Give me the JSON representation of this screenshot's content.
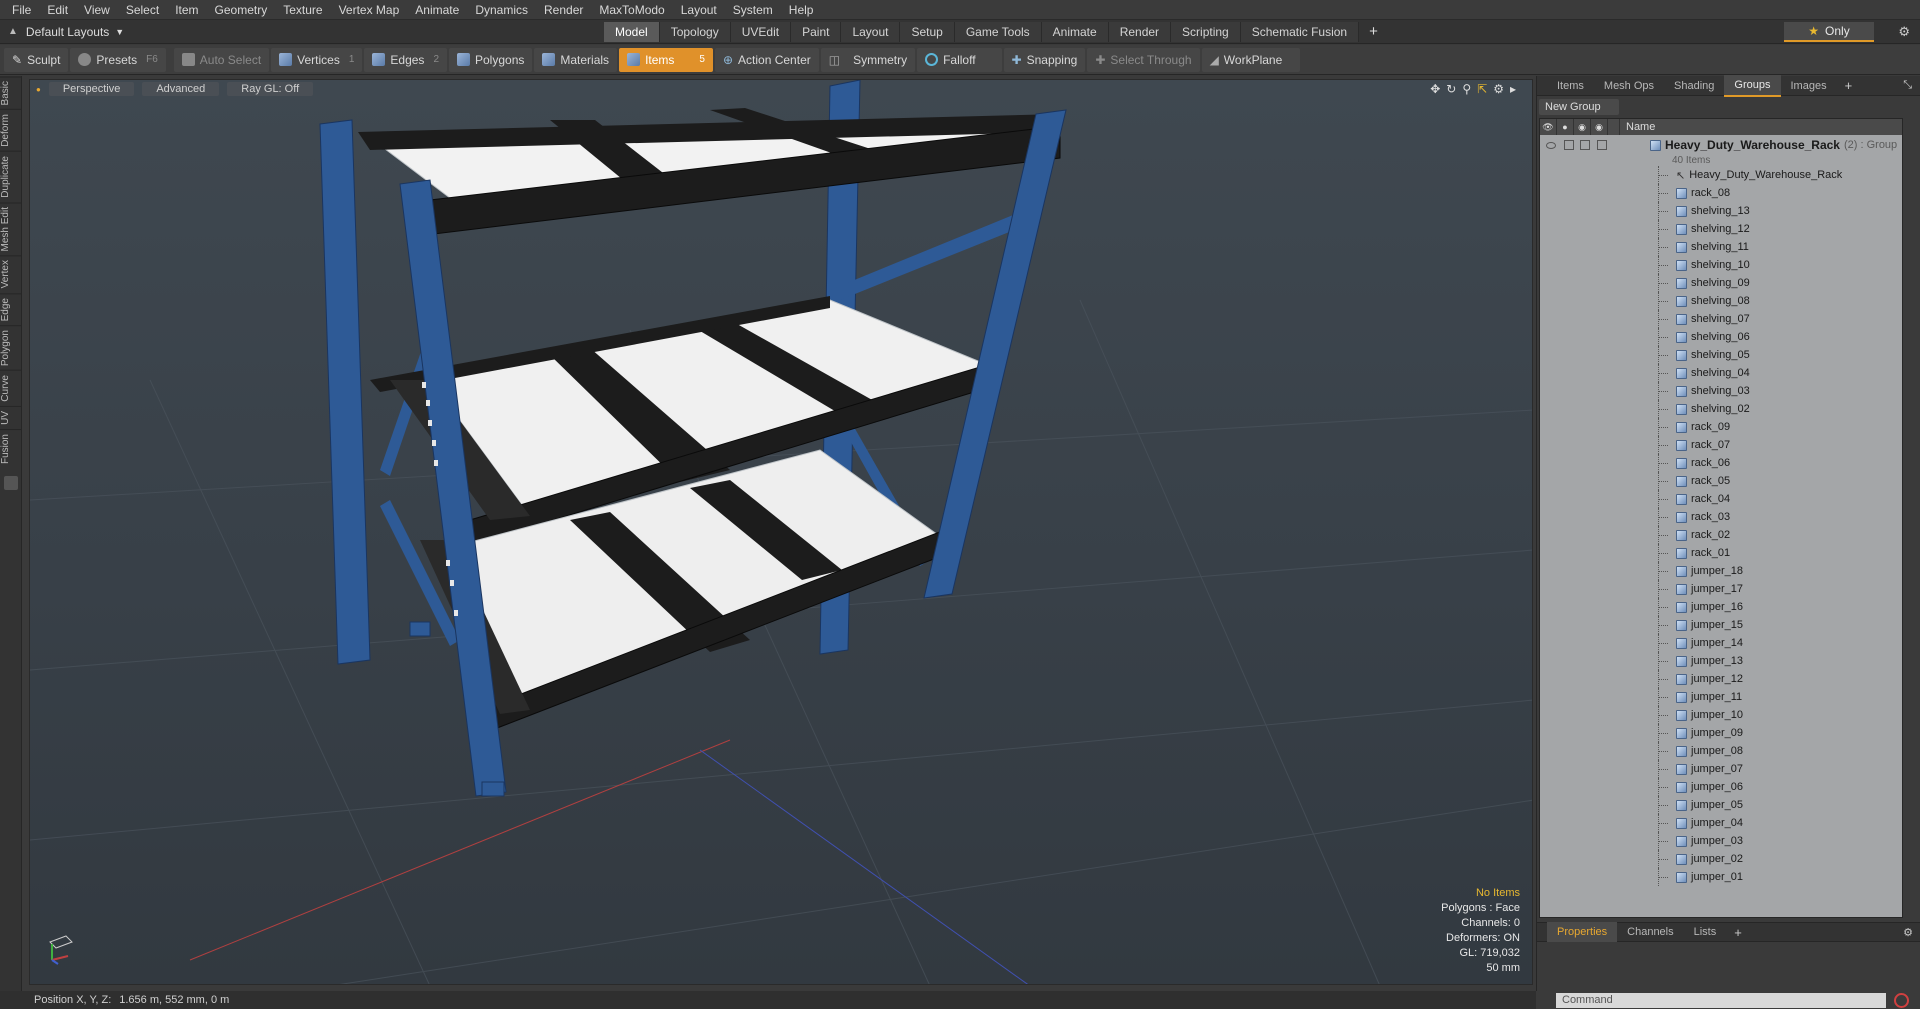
{
  "menu": [
    "File",
    "Edit",
    "View",
    "Select",
    "Item",
    "Geometry",
    "Texture",
    "Vertex Map",
    "Animate",
    "Dynamics",
    "Render",
    "MaxToModo",
    "Layout",
    "System",
    "Help"
  ],
  "layout": {
    "selector": "Default Layouts",
    "tabs": [
      "Model",
      "Topology",
      "UVEdit",
      "Paint",
      "Layout",
      "Setup",
      "Game Tools",
      "Animate",
      "Render",
      "Scripting",
      "Schematic Fusion"
    ],
    "active_tab": "Model",
    "only_label": "Only"
  },
  "toolbar": {
    "sculpt": "Sculpt",
    "presets": "Presets",
    "presets_key": "F6",
    "auto_select": "Auto Select",
    "vertices": "Vertices",
    "vertices_key": "1",
    "edges": "Edges",
    "edges_key": "2",
    "polygons": "Polygons",
    "materials": "Materials",
    "items": "Items",
    "items_key": "5",
    "action_center": "Action Center",
    "symmetry": "Symmetry",
    "falloff": "Falloff",
    "snapping": "Snapping",
    "select_through": "Select Through",
    "workplane": "WorkPlane"
  },
  "left_tabs": [
    "Basic",
    "Deform",
    "Duplicate",
    "Mesh Edit",
    "Vertex",
    "Edge",
    "Polygon",
    "Curve",
    "UV",
    "Fusion"
  ],
  "viewport": {
    "view": "Perspective",
    "shading": "Advanced",
    "raygl": "Ray GL: Off",
    "info": {
      "selection": "No Items",
      "polygons": "Polygons : Face",
      "channels": "Channels: 0",
      "deformers": "Deformers: ON",
      "gl": "GL: 719,032",
      "grid": "50 mm"
    },
    "colors": {
      "rack": "#2e5a96",
      "shelf": "#f2f2f2",
      "beam": "#1c1c1c",
      "highlight": "#e8b830"
    }
  },
  "right_panel": {
    "tabs": [
      "Items",
      "Mesh Ops",
      "Shading",
      "Groups",
      "Images"
    ],
    "active_tab": "Groups",
    "new_group": "New Group",
    "column_name": "Name",
    "group": {
      "name": "Heavy_Duty_Warehouse_Rack",
      "suffix": "(2) : Group",
      "count": "40 Items"
    },
    "items": [
      "Heavy_Duty_Warehouse_Rack",
      "rack_08",
      "shelving_13",
      "shelving_12",
      "shelving_11",
      "shelving_10",
      "shelving_09",
      "shelving_08",
      "shelving_07",
      "shelving_06",
      "shelving_05",
      "shelving_04",
      "shelving_03",
      "shelving_02",
      "rack_09",
      "rack_07",
      "rack_06",
      "rack_05",
      "rack_04",
      "rack_03",
      "rack_02",
      "rack_01",
      "jumper_18",
      "jumper_17",
      "jumper_16",
      "jumper_15",
      "jumper_14",
      "jumper_13",
      "jumper_12",
      "jumper_11",
      "jumper_10",
      "jumper_09",
      "jumper_08",
      "jumper_07",
      "jumper_06",
      "jumper_05",
      "jumper_04",
      "jumper_03",
      "jumper_02",
      "jumper_01"
    ],
    "bottom_tabs": [
      "Properties",
      "Channels",
      "Lists"
    ],
    "bottom_active": "Properties"
  },
  "status": {
    "position_label": "Position X, Y, Z:",
    "position_value": "1.656 m, 552 mm, 0 m",
    "command_placeholder": "Command"
  }
}
